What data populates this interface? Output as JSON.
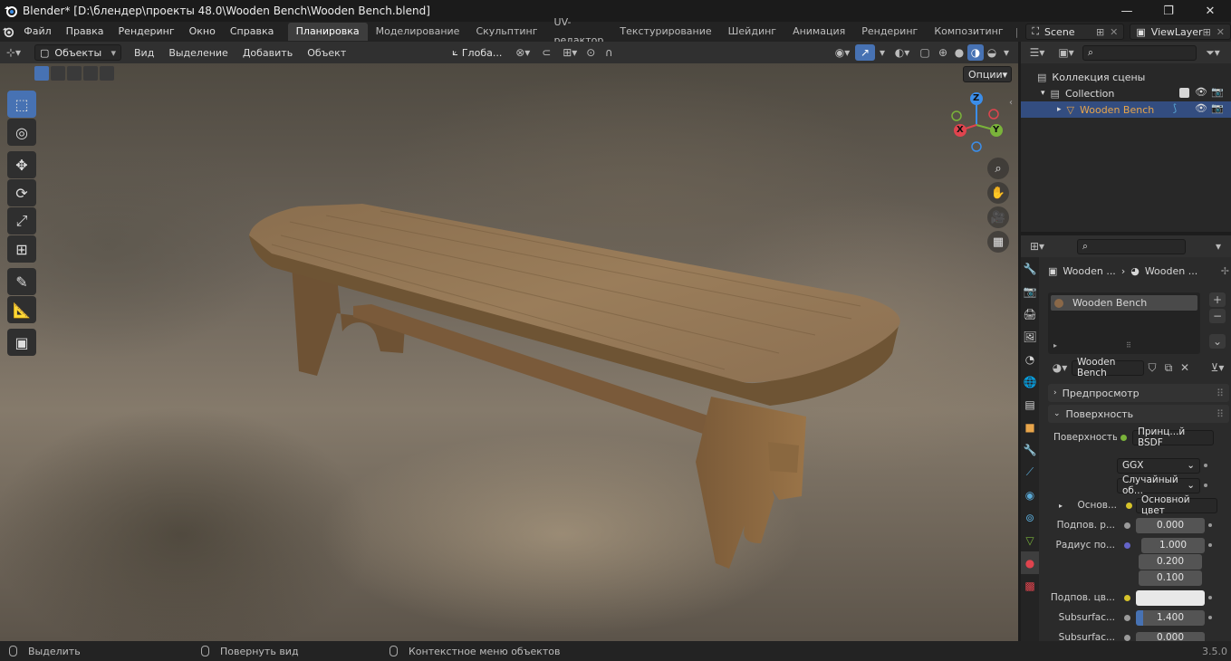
{
  "window": {
    "title": "Blender* [D:\\блендер\\проекты 48.0\\Wooden Bench\\Wooden Bench.blend]",
    "minimize": "—",
    "maximize": "❐",
    "close": "✕"
  },
  "topbar": {
    "menus": [
      "Файл",
      "Правка",
      "Рендеринг",
      "Окно",
      "Справка"
    ],
    "workspaces": [
      "Планировка",
      "Моделирование",
      "Скульптинг",
      "UV-редактор",
      "Текстурирование",
      "Шейдинг",
      "Анимация",
      "Рендеринг",
      "Композитинг"
    ],
    "active_workspace": "Планировка",
    "scene": "Scene",
    "view_layer": "ViewLayer"
  },
  "viewport_header": {
    "mode": "Объекты",
    "menus": [
      "Вид",
      "Выделение",
      "Добавить",
      "Объект"
    ],
    "transform_orientation": "Глоба...",
    "options": "Опции"
  },
  "gizmo": {
    "x": "X",
    "y": "Y",
    "z": "Z"
  },
  "outliner": {
    "root": "Коллекция сцены",
    "collection": "Collection",
    "object": "Wooden Bench"
  },
  "properties": {
    "breadcrumb_object": "Wooden ...",
    "breadcrumb_material": "Wooden ...",
    "material_slot": "Wooden Bench",
    "material_name": "Wooden Bench",
    "panel_preview": "Предпросмотр",
    "panel_surface": "Поверхность",
    "surface_label": "Поверхность",
    "surface_value": "Принц...й BSDF",
    "distribution": "GGX",
    "subsurface_method": "Случайный об...",
    "base_label": "Основ...",
    "base_value": "Основной цвет",
    "subsurface_label": "Подпов. р...",
    "subsurface_value": "0.000",
    "radius_label": "Радиус по...",
    "radius_values": [
      "1.000",
      "0.200",
      "0.100"
    ],
    "subsurface_color_label": "Подпов. цв...",
    "ior_label": "Subsurfac...",
    "ior_value": "1.400",
    "anisotropy_label": "Subsurfac...",
    "anisotropy_value": "0.000"
  },
  "status": {
    "select": "Выделить",
    "rotate": "Повернуть вид",
    "context": "Контекстное меню объектов",
    "version": "3.5.0"
  },
  "colors": {
    "accent": "#4772b3",
    "active_object": "#e8a54a",
    "x_axis": "#e0444e",
    "y_axis": "#7ab33a",
    "z_axis": "#3b8eea"
  }
}
